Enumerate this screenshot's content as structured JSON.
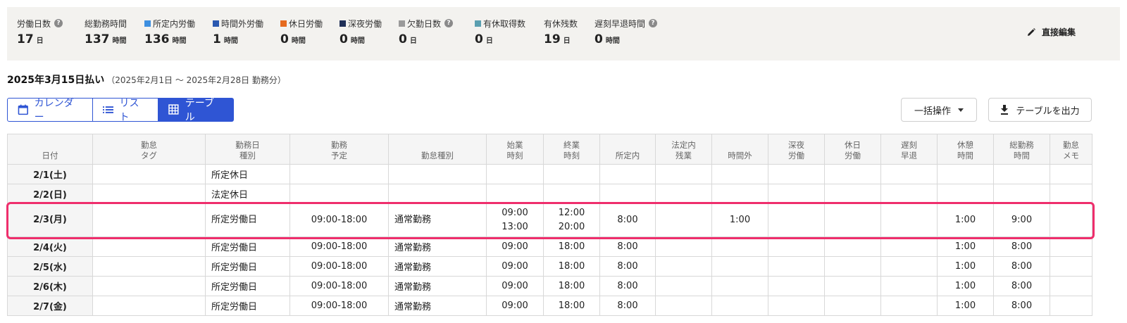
{
  "summary": {
    "stats": [
      {
        "label": "労働日数",
        "value": "17",
        "unit": "日",
        "help": true
      },
      {
        "label": "総勤務時間",
        "value": "137",
        "unit": "時間"
      },
      {
        "label": "所定内労働",
        "value": "136",
        "unit": "時間",
        "color": "#3d8fe0"
      },
      {
        "label": "時間外労働",
        "value": "1",
        "unit": "時間",
        "color": "#2a58b0"
      },
      {
        "label": "休日労働",
        "value": "0",
        "unit": "時間",
        "color": "#e66a1e"
      },
      {
        "label": "深夜労働",
        "value": "0",
        "unit": "時間",
        "color": "#1f2f57"
      },
      {
        "label": "欠勤日数",
        "value": "0",
        "unit": "日",
        "color": "#9a9a9a",
        "help": true
      },
      {
        "label": "有休取得数",
        "value": "0",
        "unit": "日",
        "color": "#5a9fb0"
      },
      {
        "label": "有休残数",
        "value": "19",
        "unit": "日"
      },
      {
        "label": "遅刻早退時間",
        "value": "0",
        "unit": "時間",
        "help": true
      }
    ],
    "edit_label": "直接編集"
  },
  "pay": {
    "title": "2025年3月15日払い",
    "period": "（2025年2月1日 ～ 2025年2月28日 勤務分）"
  },
  "views": {
    "calendar": "カレンダー",
    "list": "リスト",
    "table": "テーブル"
  },
  "actions": {
    "bulk": "一括操作",
    "export": "テーブルを出力"
  },
  "table": {
    "headers": [
      [
        "日付"
      ],
      [
        "勤怠",
        "タグ"
      ],
      [
        "勤務日",
        "種別"
      ],
      [
        "勤務",
        "予定"
      ],
      [
        "勤怠種別"
      ],
      [
        "始業",
        "時刻"
      ],
      [
        "終業",
        "時刻"
      ],
      [
        "所定内"
      ],
      [
        "法定内",
        "残業"
      ],
      [
        "時間外"
      ],
      [
        "深夜",
        "労働"
      ],
      [
        "休日",
        "労働"
      ],
      [
        "遅刻",
        "早退"
      ],
      [
        "休憩",
        "時間"
      ],
      [
        "総勤務",
        "時間"
      ],
      [
        "勤怠",
        "メモ"
      ]
    ],
    "rows": [
      {
        "date": "2/1(土)",
        "day": "sat",
        "tag": "",
        "daytype": "所定休日",
        "schedule": "",
        "kind": "",
        "start": "",
        "end": "",
        "regular": "",
        "legal_ot": "",
        "overtime": "",
        "night": "",
        "holiday": "",
        "late": "",
        "break": "",
        "total": "",
        "memo": ""
      },
      {
        "date": "2/2(日)",
        "day": "sun",
        "tag": "",
        "daytype": "法定休日",
        "schedule": "",
        "kind": "",
        "start": "",
        "end": "",
        "regular": "",
        "legal_ot": "",
        "overtime": "",
        "night": "",
        "holiday": "",
        "late": "",
        "break": "",
        "total": "",
        "memo": ""
      },
      {
        "date": "2/3(月)",
        "day": "wk",
        "tag": "",
        "daytype": "所定労働日",
        "schedule": "09:00-18:00",
        "kind": "通常勤務",
        "start": "09:00",
        "start2": "13:00",
        "end": "12:00",
        "end2": "20:00",
        "regular": "8:00",
        "legal_ot": "",
        "overtime": "1:00",
        "night": "",
        "holiday": "",
        "late": "",
        "break": "1:00",
        "total": "9:00",
        "memo": ""
      },
      {
        "date": "2/4(火)",
        "day": "wk",
        "tag": "",
        "daytype": "所定労働日",
        "schedule": "09:00-18:00",
        "kind": "通常勤務",
        "start": "09:00",
        "end": "18:00",
        "regular": "8:00",
        "legal_ot": "",
        "overtime": "",
        "night": "",
        "holiday": "",
        "late": "",
        "break": "1:00",
        "total": "8:00",
        "memo": ""
      },
      {
        "date": "2/5(水)",
        "day": "wk",
        "tag": "",
        "daytype": "所定労働日",
        "schedule": "09:00-18:00",
        "kind": "通常勤務",
        "start": "09:00",
        "end": "18:00",
        "regular": "8:00",
        "legal_ot": "",
        "overtime": "",
        "night": "",
        "holiday": "",
        "late": "",
        "break": "1:00",
        "total": "8:00",
        "memo": ""
      },
      {
        "date": "2/6(木)",
        "day": "wk",
        "tag": "",
        "daytype": "所定労働日",
        "schedule": "09:00-18:00",
        "kind": "通常勤務",
        "start": "09:00",
        "end": "18:00",
        "regular": "8:00",
        "legal_ot": "",
        "overtime": "",
        "night": "",
        "holiday": "",
        "late": "",
        "break": "1:00",
        "total": "8:00",
        "memo": ""
      },
      {
        "date": "2/7(金)",
        "day": "wk",
        "tag": "",
        "daytype": "所定労働日",
        "schedule": "09:00-18:00",
        "kind": "通常勤務",
        "start": "09:00",
        "end": "18:00",
        "regular": "8:00",
        "legal_ot": "",
        "overtime": "",
        "night": "",
        "holiday": "",
        "late": "",
        "break": "1:00",
        "total": "8:00",
        "memo": ""
      }
    ]
  },
  "highlight_color": "#ef2e6c"
}
